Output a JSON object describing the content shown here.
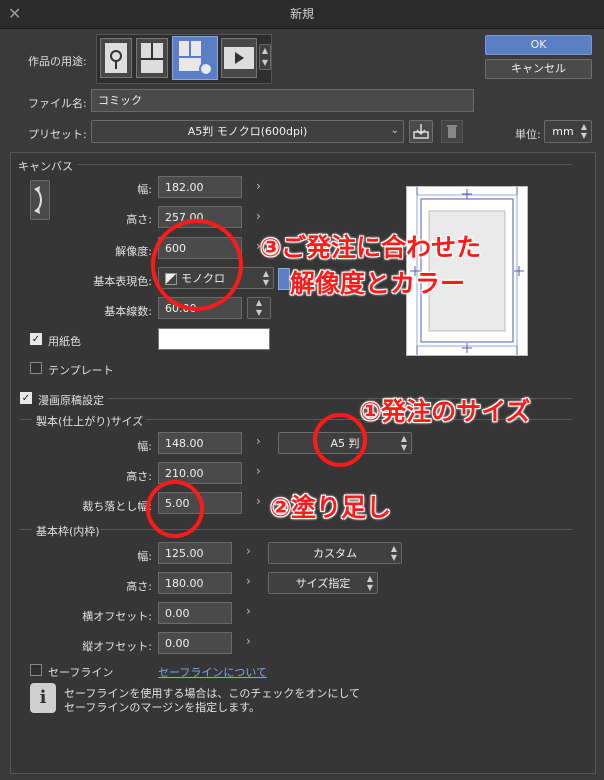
{
  "window": {
    "title": "新規"
  },
  "buttons": {
    "ok": "OK",
    "cancel": "キャンセル"
  },
  "usage": {
    "label": "作品の用途:"
  },
  "filename": {
    "label": "ファイル名:",
    "value": "コミック"
  },
  "preset": {
    "label": "プリセット:",
    "value": "A5判 モノクロ(600dpi)"
  },
  "unit": {
    "label": "単位:",
    "value": "mm"
  },
  "canvas": {
    "section": "キャンバス",
    "width_label": "幅:",
    "width": "182.00",
    "height_label": "高さ:",
    "height": "257.00",
    "resolution_label": "解像度:",
    "resolution": "600",
    "color_label": "基本表現色:",
    "color": "モノクロ",
    "lines_label": "基本線数:",
    "lines": "60.00",
    "paper_color_label": "用紙色",
    "template_label": "テンプレート"
  },
  "manga": {
    "section": "漫画原稿設定",
    "finish_section": "製本(仕上がり)サイズ",
    "finish_width_label": "幅:",
    "finish_width": "148.00",
    "finish_size": "A5 判",
    "finish_height_label": "高さ:",
    "finish_height": "210.00",
    "bleed_label": "裁ち落とし幅:",
    "bleed": "5.00",
    "frame_section": "基本枠(内枠)",
    "frame_width_label": "幅:",
    "frame_width": "125.00",
    "frame_mode": "カスタム",
    "frame_height_label": "高さ:",
    "frame_height": "180.00",
    "frame_size_mode": "サイズ指定",
    "h_offset_label": "横オフセット:",
    "h_offset": "0.00",
    "v_offset_label": "縦オフセット:",
    "v_offset": "0.00",
    "safeline_label": "セーフライン",
    "safeline_link": "セーフラインについて",
    "info_line1": "セーフラインを使用する場合は、このチェックをオンにして",
    "info_line2": "セーフラインのマージンを指定します。"
  },
  "annotations": {
    "a1": "①発注のサイズ",
    "a2": "②塗り足し",
    "a3_line1": "③ご発注に合わせた",
    "a3_line2": "解像度とカラー"
  },
  "colors": {
    "annotation": "#ff1a1a",
    "accent": "#5b7fc4"
  }
}
